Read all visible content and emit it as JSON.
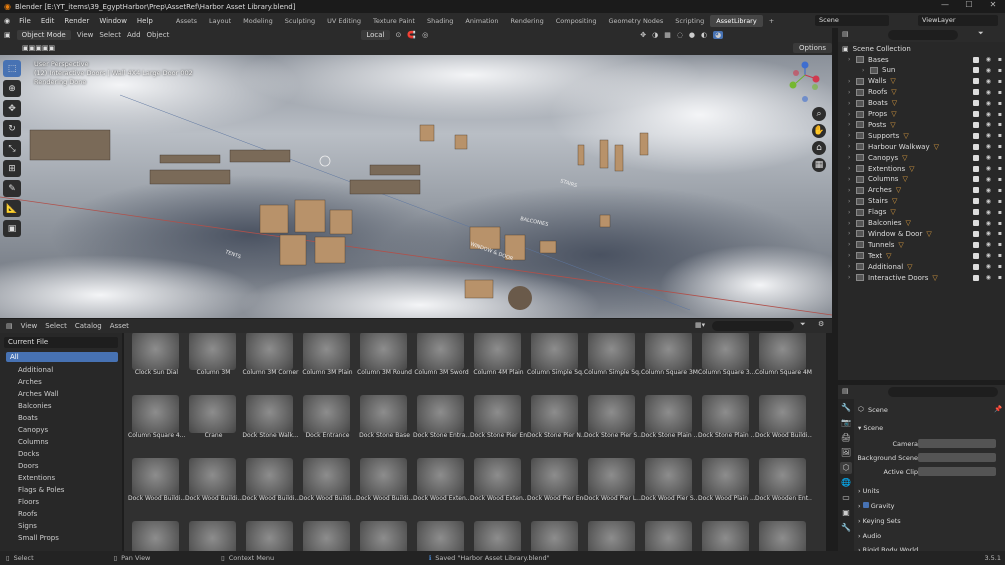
{
  "titlebar": {
    "title": "Blender [E:\\YT_items\\39_EgyptHarbor\\Prep\\AssetRef\\Harbor Asset Library.blend]",
    "minimize": "—",
    "maximize": "☐",
    "close": "✕"
  },
  "menus": [
    "File",
    "Edit",
    "Render",
    "Window",
    "Help"
  ],
  "workspaces": [
    "Assets",
    "Layout",
    "Modeling",
    "Sculpting",
    "UV Editing",
    "Texture Paint",
    "Shading",
    "Animation",
    "Rendering",
    "Compositing",
    "Geometry Nodes",
    "Scripting",
    "AssetLibrary",
    "+"
  ],
  "active_workspace": "AssetLibrary",
  "scene_name": "Scene",
  "view_layer": "ViewLayer",
  "viewport": {
    "mode": "Object Mode",
    "menus": [
      "View",
      "Select",
      "Add",
      "Object"
    ],
    "transform_orientation": "Local",
    "options_label": "Options",
    "info_line1": "User Perspective",
    "info_line2": "(12) Interactive Doors | Wall 4X4 Large Door 002",
    "info_line3": "Rendering Done",
    "floor_labels": [
      "BALCONIES",
      "WINDOW & DOOR",
      "TENTS",
      "STAIRS"
    ]
  },
  "asset_browser": {
    "menus": [
      "View",
      "Select",
      "Catalog",
      "Asset"
    ],
    "library": "Current File",
    "all_label": "All",
    "catalogs": [
      "Additional",
      "Arches",
      "Arches Wall",
      "Balconies",
      "Boats",
      "Canopys",
      "Columns",
      "Docks",
      "Doors",
      "Extentions",
      "Flags & Poles",
      "Floors",
      "Roofs",
      "Signs",
      "Small Props"
    ],
    "assets": [
      "Clock Sun Dial",
      "Column 3M",
      "Column 3M Corner",
      "Column 3M Plain",
      "Column 3M Round",
      "Column 3M Sword",
      "Column 4M Plain",
      "Column Simple Sq...",
      "Column Simple Sq...",
      "Column Square 3M",
      "Column Square 3...",
      "Column Square 4M",
      "Column Square 4...",
      "Crane",
      "Dock Stone Walk...",
      "Dock Entrance",
      "Dock Stone Base",
      "Dock Stone Entra...",
      "Dock Stone Pier End",
      "Dock Stone Pier N...",
      "Dock Stone Pier S...",
      "Dock Stone Plain ...",
      "Dock Stone Plain ...",
      "Dock Wood Buildi...",
      "Dock Wood Buildi...",
      "Dock Wood Buildi...",
      "Dock Wood Buildi...",
      "Dock Wood Buildi...",
      "Dock Wood Buildi...",
      "Dock Wood Exten...",
      "Dock Wood Exten...",
      "Dock Wood Pier End",
      "Dock Wood Pier L...",
      "Dock Wood Pier S...",
      "Dock Wood Plain ...",
      "Dock Wooden Ent...",
      "",
      "",
      "",
      "",
      "",
      "",
      "",
      "",
      "",
      "",
      "",
      ""
    ]
  },
  "outliner": {
    "root": "Scene Collection",
    "items": [
      {
        "name": "Bases",
        "badge": ""
      },
      {
        "name": "Sun",
        "badge": ""
      },
      {
        "name": "Walls",
        "badge": "▽"
      },
      {
        "name": "Roofs",
        "badge": "▽"
      },
      {
        "name": "Boats",
        "badge": "▽"
      },
      {
        "name": "Props",
        "badge": "▽"
      },
      {
        "name": "Posts",
        "badge": "▽"
      },
      {
        "name": "Supports",
        "badge": "▽"
      },
      {
        "name": "Harbour Walkway",
        "badge": "▽"
      },
      {
        "name": "Canopys",
        "badge": "▽"
      },
      {
        "name": "Extentions",
        "badge": "▽"
      },
      {
        "name": "Columns",
        "badge": "▽"
      },
      {
        "name": "Arches",
        "badge": "▽"
      },
      {
        "name": "Stairs",
        "badge": "▽"
      },
      {
        "name": "Flags",
        "badge": "▽"
      },
      {
        "name": "Balconies",
        "badge": "▽"
      },
      {
        "name": "Window & Door",
        "badge": "▽"
      },
      {
        "name": "Tunnels",
        "badge": "▽"
      },
      {
        "name": "Text",
        "badge": "▽"
      },
      {
        "name": "Additional",
        "badge": "▽"
      },
      {
        "name": "Interactive Doors",
        "badge": "▽"
      }
    ]
  },
  "properties": {
    "panel_title": "Scene",
    "section": "Scene",
    "camera_label": "Camera",
    "bg_scene_label": "Background Scene",
    "active_clip_label": "Active Clip",
    "subpanels": [
      "Units",
      "Gravity",
      "Keying Sets",
      "Audio",
      "Rigid Body World"
    ]
  },
  "status": {
    "select": "Select",
    "pan": "Pan View",
    "context": "Context Menu",
    "message": "Saved \"Harbor Asset Library.blend\"",
    "version": "3.5.1"
  }
}
